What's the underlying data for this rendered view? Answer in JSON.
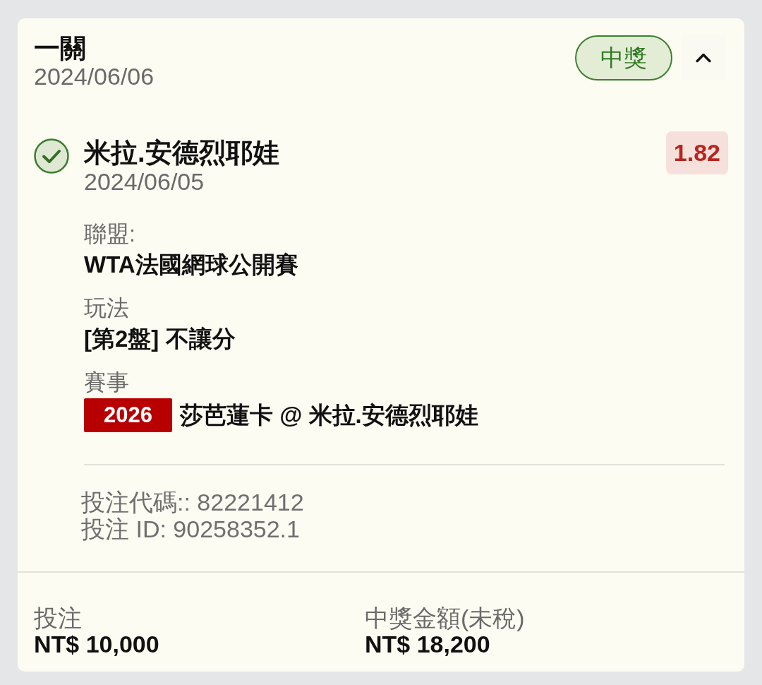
{
  "bet": {
    "type": "一關",
    "date": "2024/06/06",
    "status_badge": {
      "label": "中獎",
      "kind": "won"
    },
    "expanded": true
  },
  "selections": [
    {
      "name": "米拉.安德烈耶娃",
      "date": "2024/06/05",
      "won": true,
      "odds": "1.82",
      "details": [
        {
          "kind": "text",
          "label": "聯盟:",
          "value": "WTA法國網球公開賽"
        },
        {
          "kind": "text",
          "label": "玩法",
          "value": "[第2盤] 不讓分"
        },
        {
          "kind": "event",
          "label": "賽事",
          "event_code": "2026",
          "value": "莎芭蓮卡 @ 米拉.安德烈耶娃"
        }
      ],
      "bet_codes": [
        "投注代碼:: 82221412",
        "投注 ID: 90258352.1"
      ]
    }
  ],
  "summary": [
    {
      "label": "投注",
      "value": "NT$ 10,000"
    },
    {
      "label": "中獎金額(未稅)",
      "value": "NT$ 18,200"
    }
  ]
}
